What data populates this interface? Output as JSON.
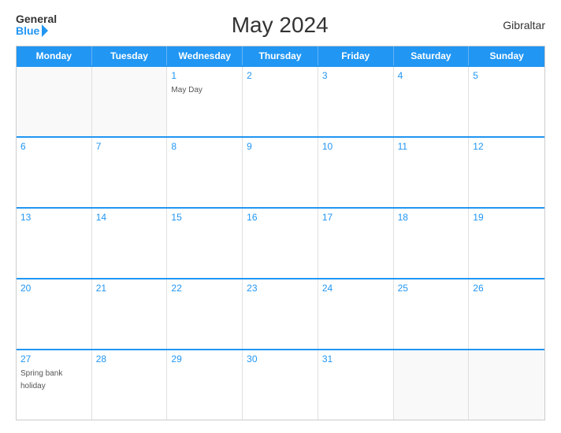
{
  "header": {
    "logo_general": "General",
    "logo_blue": "Blue",
    "title": "May 2024",
    "region": "Gibraltar"
  },
  "calendar": {
    "days": [
      "Monday",
      "Tuesday",
      "Wednesday",
      "Thursday",
      "Friday",
      "Saturday",
      "Sunday"
    ],
    "weeks": [
      [
        {
          "day": "",
          "empty": true
        },
        {
          "day": "",
          "empty": true
        },
        {
          "day": "1",
          "event": "May Day"
        },
        {
          "day": "2"
        },
        {
          "day": "3"
        },
        {
          "day": "4"
        },
        {
          "day": "5"
        }
      ],
      [
        {
          "day": "6"
        },
        {
          "day": "7"
        },
        {
          "day": "8"
        },
        {
          "day": "9"
        },
        {
          "day": "10"
        },
        {
          "day": "11"
        },
        {
          "day": "12"
        }
      ],
      [
        {
          "day": "13"
        },
        {
          "day": "14"
        },
        {
          "day": "15"
        },
        {
          "day": "16"
        },
        {
          "day": "17"
        },
        {
          "day": "18"
        },
        {
          "day": "19"
        }
      ],
      [
        {
          "day": "20"
        },
        {
          "day": "21"
        },
        {
          "day": "22"
        },
        {
          "day": "23"
        },
        {
          "day": "24"
        },
        {
          "day": "25"
        },
        {
          "day": "26"
        }
      ],
      [
        {
          "day": "27",
          "event": "Spring bank holiday"
        },
        {
          "day": "28"
        },
        {
          "day": "29"
        },
        {
          "day": "30"
        },
        {
          "day": "31"
        },
        {
          "day": "",
          "empty": true
        },
        {
          "day": "",
          "empty": true
        }
      ]
    ]
  }
}
